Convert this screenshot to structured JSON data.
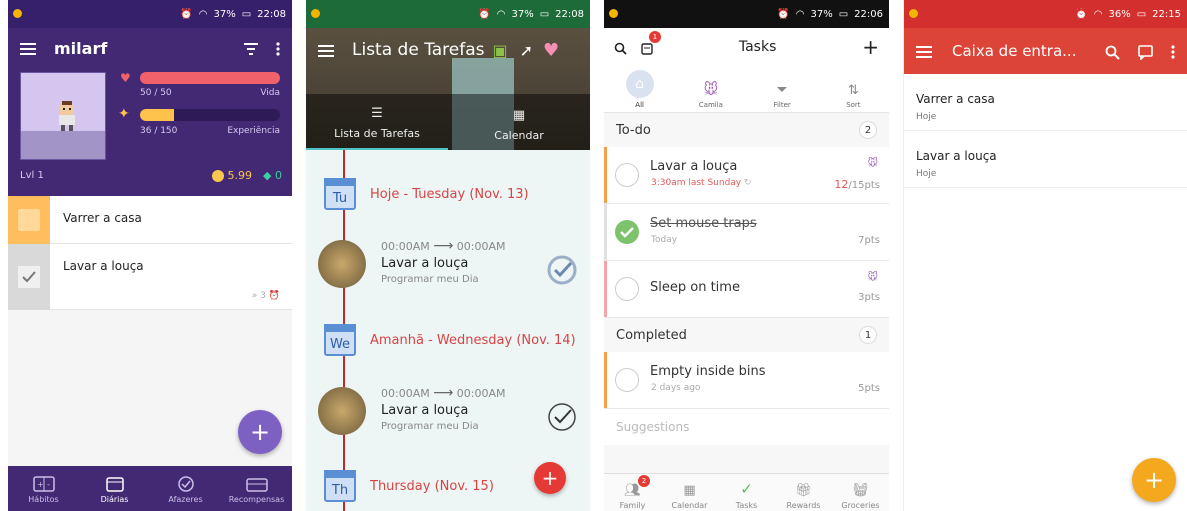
{
  "status": {
    "s1": {
      "battery": "37%",
      "time": "22:08"
    },
    "s2": {
      "battery": "37%",
      "time": "22:08"
    },
    "s3": {
      "battery": "37%",
      "time": "22:06"
    },
    "s4": {
      "battery": "36%",
      "time": "22:15"
    }
  },
  "habitica": {
    "username": "milarf",
    "hp_text": "50 / 50",
    "hp_label": "Vida",
    "hp_fraction": 1.0,
    "xp_text": "36 / 150",
    "xp_label": "Experiência",
    "xp_fraction": 0.24,
    "level": "Lvl 1",
    "gold": "5.99",
    "gems": "0",
    "tasks": [
      {
        "label": "Varrer a casa",
        "checked": false
      },
      {
        "label": "Lavar a louça",
        "checked": true,
        "streak": "3"
      }
    ],
    "fab": "+",
    "nav": [
      {
        "label": "Hábitos",
        "icon": "habits-icon",
        "active": false
      },
      {
        "label": "Diárias",
        "icon": "calendar-icon",
        "active": true
      },
      {
        "label": "Afazeres",
        "icon": "check-circle-icon",
        "active": false
      },
      {
        "label": "Recompensas",
        "icon": "reward-icon",
        "active": false
      }
    ],
    "colors": {
      "primary": "#432874",
      "hp": "#f0616c",
      "xp": "#ffc24c",
      "fab": "#7d61c2"
    }
  },
  "lista": {
    "title": "Lista de Tarefas",
    "tabs": [
      {
        "label": "Lista de Tarefas",
        "active": true
      },
      {
        "label": "Calendar",
        "active": false
      }
    ],
    "days": [
      {
        "abbr": "Tu",
        "label": "Hoje - Tuesday (Nov. 13)"
      },
      {
        "abbr": "We",
        "label": "Amanhã - Wednesday (Nov. 14)"
      },
      {
        "abbr": "Th",
        "label": "Thursday (Nov. 15)"
      }
    ],
    "tasks": [
      {
        "start": "00:00AM",
        "end": "00:00AM",
        "name": "Lavar a louça",
        "sub": "Programar meu Dia"
      },
      {
        "start": "00:00AM",
        "end": "00:00AM",
        "name": "Lavar a louça",
        "sub": "Programar meu Dia"
      }
    ],
    "fab": "+"
  },
  "tasks_app": {
    "title": "Tasks",
    "notif_count": "1",
    "filters": [
      {
        "label": "All",
        "icon": "home-icon"
      },
      {
        "label": "Camila",
        "icon": "mouse-icon"
      },
      {
        "label": "Filter",
        "icon": "filter-icon"
      },
      {
        "label": "Sort",
        "icon": "sort-icon"
      }
    ],
    "todo_label": "To-do",
    "todo_count": "2",
    "todo": [
      {
        "name": "Lavar a louça",
        "sub": "3:30am last Sunday",
        "points_done": "12",
        "points_total": "/15pts",
        "done": false,
        "sub_red": true
      },
      {
        "name": "Set mouse traps",
        "sub": "Today",
        "points": "7pts",
        "done": true
      },
      {
        "name": "Sleep on time",
        "sub": "",
        "points": "3pts",
        "done": false
      }
    ],
    "completed_label": "Completed",
    "completed_count": "1",
    "completed": [
      {
        "name": "Empty inside bins",
        "sub": "2 days ago",
        "points": "5pts"
      }
    ],
    "suggestions_label": "Suggestions",
    "nav": [
      {
        "label": "Family",
        "badge": "2"
      },
      {
        "label": "Calendar",
        "badge": ""
      },
      {
        "label": "Tasks",
        "badge": ""
      },
      {
        "label": "Rewards",
        "badge": ""
      },
      {
        "label": "Groceries",
        "badge": ""
      }
    ]
  },
  "inbox": {
    "title": "Caixa de entra...",
    "items": [
      {
        "name": "Varrer a casa",
        "sub": "Hoje"
      },
      {
        "name": "Lavar a louça",
        "sub": "Hoje"
      }
    ],
    "fab": "+",
    "colors": {
      "primary": "#db4437",
      "fab": "#f4a81d"
    }
  }
}
